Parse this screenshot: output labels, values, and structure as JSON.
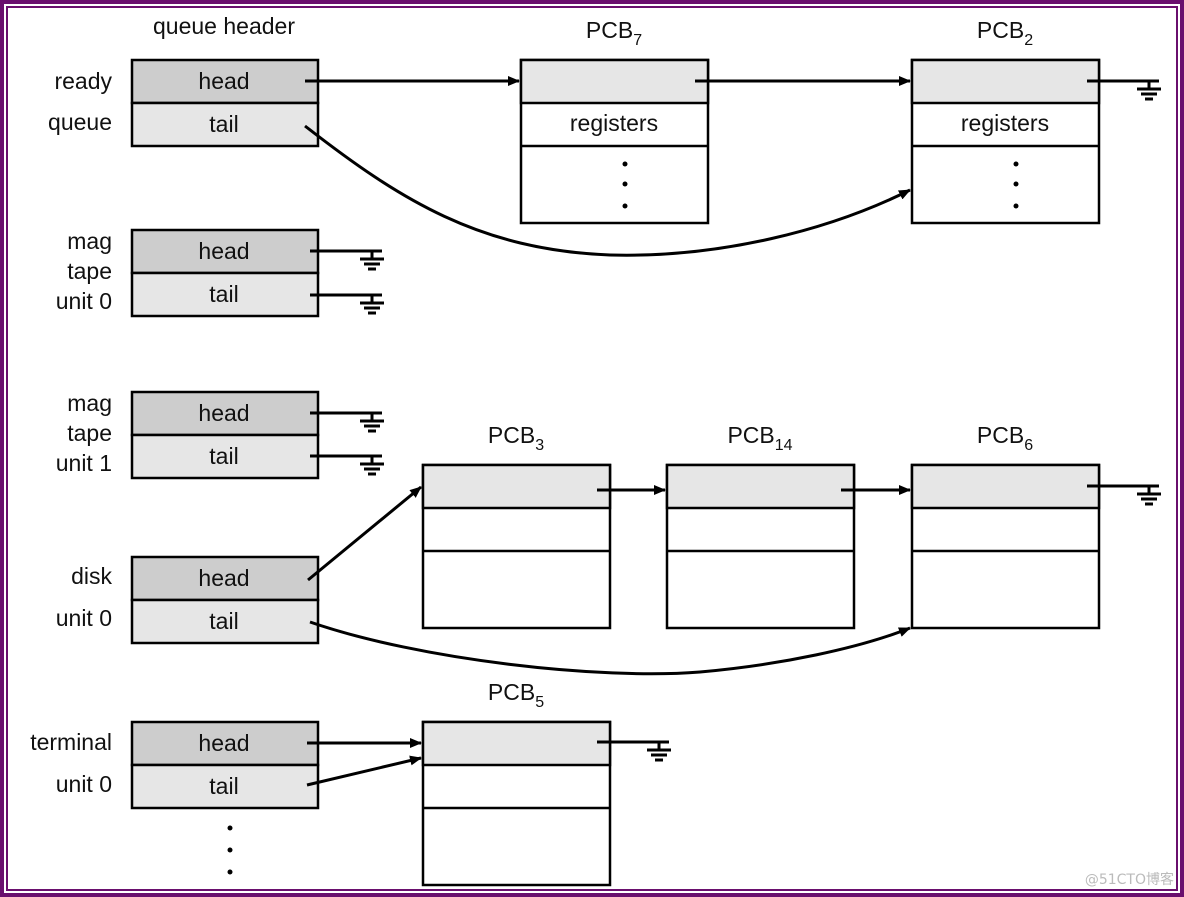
{
  "header_title": "queue header",
  "queues": [
    {
      "label": [
        "ready",
        "queue"
      ],
      "head": "head",
      "tail": "tail"
    },
    {
      "label": [
        "mag",
        "tape",
        "unit 0"
      ],
      "head": "head",
      "tail": "tail"
    },
    {
      "label": [
        "mag",
        "tape",
        "unit 1"
      ],
      "head": "head",
      "tail": "tail"
    },
    {
      "label": [
        "disk",
        "unit 0"
      ],
      "head": "head",
      "tail": "tail"
    },
    {
      "label": [
        "terminal",
        "unit 0"
      ],
      "head": "head",
      "tail": "tail"
    }
  ],
  "pcbs": [
    {
      "name": "PCB",
      "sub": "7",
      "field": "registers"
    },
    {
      "name": "PCB",
      "sub": "2",
      "field": "registers"
    },
    {
      "name": "PCB",
      "sub": "3"
    },
    {
      "name": "PCB",
      "sub": "14"
    },
    {
      "name": "PCB",
      "sub": "6"
    },
    {
      "name": "PCB",
      "sub": "5"
    }
  ],
  "colors": {
    "frame": "#6a0f6e",
    "head_fill": "#cdcdcd",
    "tail_fill": "#e6e6e6"
  },
  "watermark": "@51CTO博客"
}
